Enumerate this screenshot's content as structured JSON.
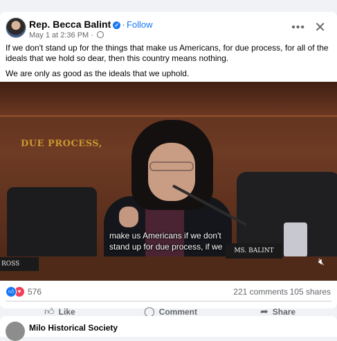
{
  "post": {
    "author": "Rep. Becca Balint",
    "follow_label": "Follow",
    "timestamp": "May 1 at 2:36 PM",
    "more_icon": "more-options-icon",
    "close_icon": "close-icon",
    "text_p1": "If we don't stand up for the things that make us Americans, for due process, for all of the ideals that we hold so dear, then this country means nothing.",
    "text_p2": "We are only as good as the ideals that we uphold."
  },
  "video": {
    "wall_text": "DUE PROCESS,",
    "nameplate_left": "ROSS",
    "nameplate_right": "MS. BALINT",
    "caption_line1": "make us Americans if we don't",
    "caption_line2": "stand up for due process, if we",
    "volume_icon": "volume-muted-icon"
  },
  "engagement": {
    "reaction_count": "576",
    "comments": "221 comments",
    "shares": "105 shares"
  },
  "actions": {
    "like": "Like",
    "comment": "Comment",
    "share": "Share"
  },
  "next_post": {
    "author": "Milo Historical Society"
  },
  "colors": {
    "accent": "#1877f2",
    "love": "#f33e58",
    "muted_text": "#65676b",
    "background": "#f0f2f5"
  }
}
